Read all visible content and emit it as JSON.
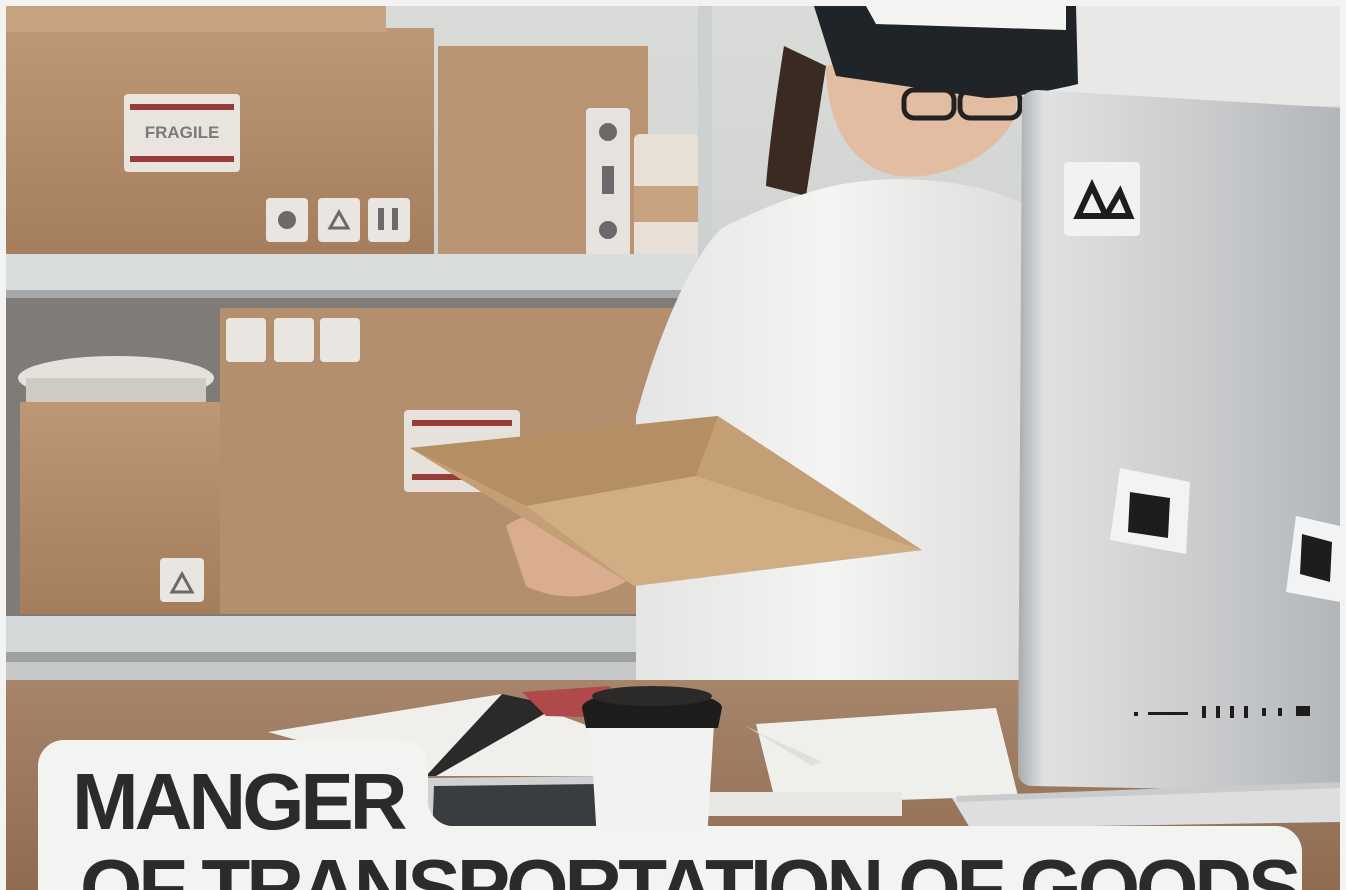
{
  "title": {
    "line1": "MANGER",
    "line2": "OF TRANSPORTATION OF GOODS"
  },
  "photo": {
    "box_label": "FRAGILE"
  },
  "colors": {
    "background": "#f3f3f1",
    "title_text": "#2b2b2b",
    "cardboard": "#b08a68",
    "shelf": "#d7dadb",
    "monitor": "#c9cbcd"
  }
}
